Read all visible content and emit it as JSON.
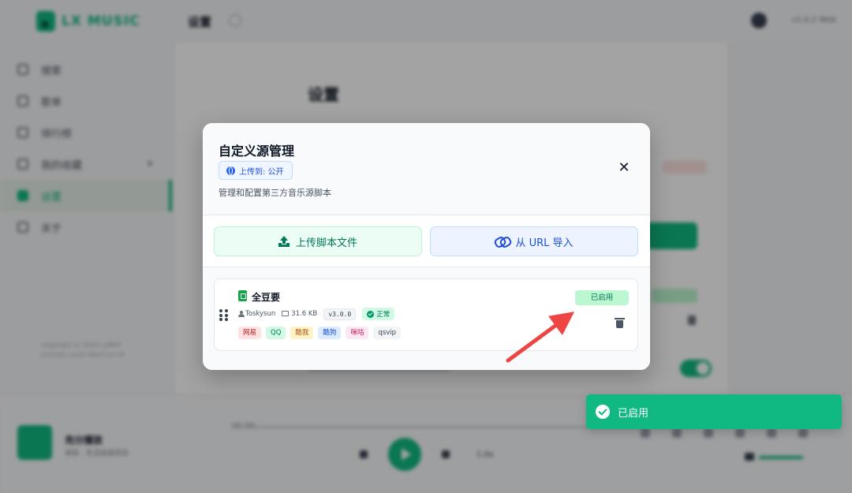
{
  "app": {
    "logo_text": "LX MUSIC",
    "nav": [
      {
        "label": "搜索",
        "icon": "search-icon"
      },
      {
        "label": "歌单",
        "icon": "playlist-icon"
      },
      {
        "label": "排行榜",
        "icon": "chart-icon"
      },
      {
        "label": "我的收藏",
        "icon": "folder-icon"
      },
      {
        "label": "设置",
        "icon": "gear-icon",
        "active": true
      },
      {
        "label": "关于",
        "icon": "info-icon"
      }
    ],
    "copyright_line1": "Copyright © 2024 LxMHT",
    "copyright_line2": "Lxmusic Lover Band on LX",
    "top_title": "设置",
    "top_version": "v1.0.2 Web",
    "content_title": "设置"
  },
  "player": {
    "song_name": "充分播放",
    "song_artist": "未知 - 生活自由空白",
    "time_left": "00:00",
    "speed": "1.0x"
  },
  "modal": {
    "title": "自定义源管理",
    "upload_target": "上传到: 公开",
    "description": "管理和配置第三方音乐源脚本",
    "upload_button": "上传脚本文件",
    "url_button": "从 URL 导入",
    "sources": [
      {
        "name": "全豆要",
        "author": "Toskysun",
        "size": "31.6 KB",
        "version": "v3.0.0",
        "status": "正常",
        "enabled_label": "已启用",
        "tags": [
          {
            "label": "网易",
            "bg": "#fee2e2",
            "fg": "#b91c1c"
          },
          {
            "label": "QQ",
            "bg": "#d1fae5",
            "fg": "#047857"
          },
          {
            "label": "酷我",
            "bg": "#fef3c7",
            "fg": "#b45309"
          },
          {
            "label": "酷狗",
            "bg": "#dbeafe",
            "fg": "#1d4ed8"
          },
          {
            "label": "咪咕",
            "bg": "#fce7f3",
            "fg": "#be185d"
          },
          {
            "label": "qsvip",
            "bg": "#f3f4f6",
            "fg": "#374151"
          }
        ]
      }
    ]
  },
  "toast": {
    "message": "已启用"
  },
  "colors": {
    "accent": "#10b981",
    "annotation_arrow": "#ef4444"
  }
}
